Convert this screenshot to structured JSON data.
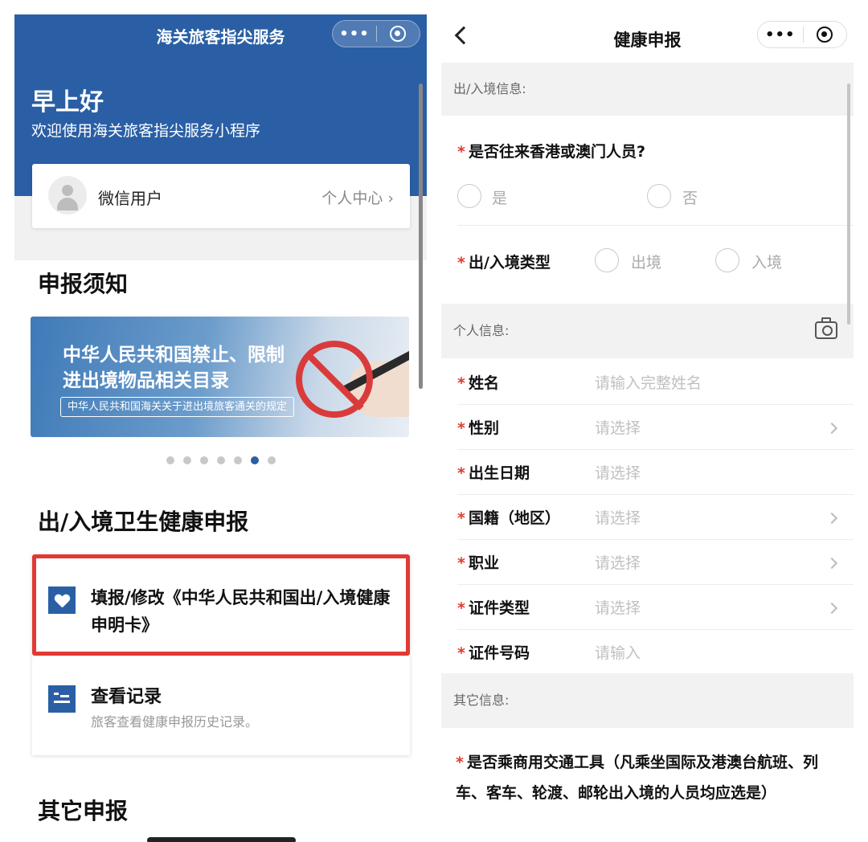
{
  "left": {
    "app_title": "海关旅客指尖服务",
    "capsule_more": "•••",
    "greeting": "早上好",
    "welcome": "欢迎使用海关旅客指尖服务小程序",
    "user_name": "微信用户",
    "personal_center": "个人中心 ›",
    "section_notice": "申报须知",
    "banner": {
      "line1": "中华人民共和国禁止、限制",
      "line2": "进出境物品相关目录",
      "tag": "中华人民共和国海关关于进出境旅客通关的规定"
    },
    "carousel_active_index": 5,
    "carousel_count": 7,
    "section_health": "出/入境卫生健康申报",
    "fill_item": "填报/修改《中华人民共和国出/入境健康申明卡》",
    "records_title": "查看记录",
    "records_sub": "旅客查看健康申报历史记录。",
    "section_other": "其它申报"
  },
  "right": {
    "page_title": "健康申报",
    "capsule_more": "•••",
    "sec_travel": "出/入境信息:",
    "q_hkmo": "是否往来香港或澳门人员?",
    "opt_yes": "是",
    "opt_no": "否",
    "q_direction": "出/入境类型",
    "opt_exit": "出境",
    "opt_entry": "入境",
    "sec_personal": "个人信息:",
    "fields": [
      {
        "label": "姓名",
        "value": "请输入完整姓名"
      },
      {
        "label": "性别",
        "value": "请选择"
      },
      {
        "label": "出生日期",
        "value": "请选择"
      },
      {
        "label": "国籍（地区）",
        "value": "请选择"
      },
      {
        "label": "职业",
        "value": "请选择"
      },
      {
        "label": "证件类型",
        "value": "请选择"
      },
      {
        "label": "证件号码",
        "value": "请输入"
      }
    ],
    "sec_other": "其它信息:",
    "q_transport": "是否乘商用交通工具（凡乘坐国际及港澳台航班、列车、客车、轮渡、邮轮出入境的人员均应选是）",
    "required_mark": "*"
  }
}
